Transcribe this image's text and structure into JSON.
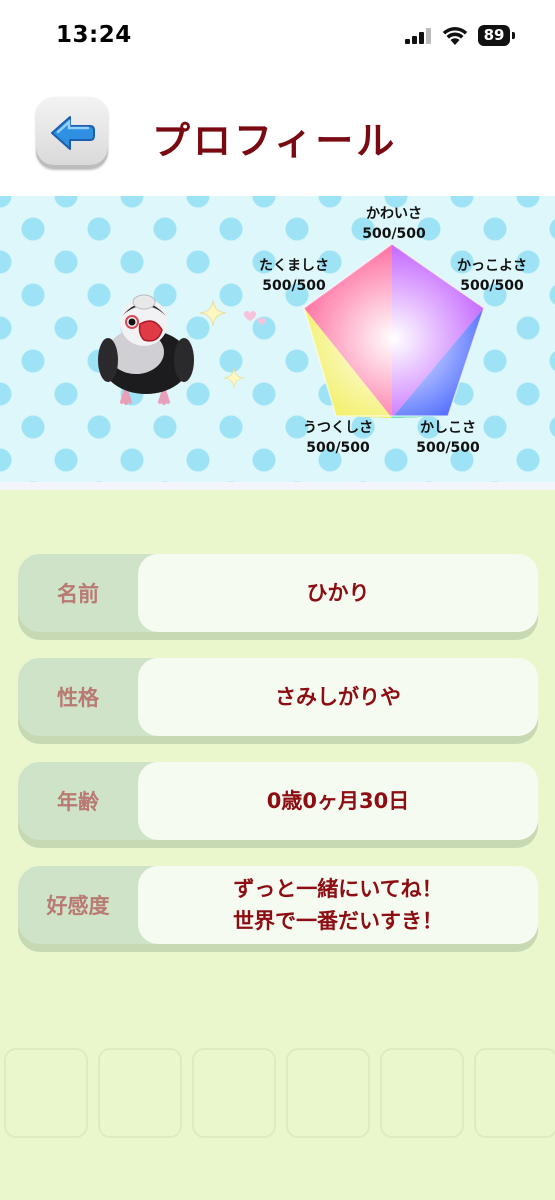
{
  "status_bar": {
    "time": "13:24",
    "battery": "89"
  },
  "header": {
    "title": "プロフィール"
  },
  "radar": {
    "stats": [
      {
        "name": "かわいさ",
        "value": "500/500"
      },
      {
        "name": "かっこよさ",
        "value": "500/500"
      },
      {
        "name": "かしこさ",
        "value": "500/500"
      },
      {
        "name": "うつくしさ",
        "value": "500/500"
      },
      {
        "name": "たくましさ",
        "value": "500/500"
      }
    ]
  },
  "profile": {
    "name_label": "名前",
    "name_value": "ひかり",
    "personality_label": "性格",
    "personality_value": "さみしがりや",
    "age_label": "年齢",
    "age_value": "0歳0ヶ月30日",
    "affection_label": "好感度",
    "affection_line1": "ずっと一緒にいてね！",
    "affection_line2": "世界で一番だいすき！"
  },
  "colors": {
    "title": "#7a0a12",
    "value_text": "#8c0d12",
    "label_text": "#b87a73",
    "back_arrow": "#2f8fe0"
  }
}
